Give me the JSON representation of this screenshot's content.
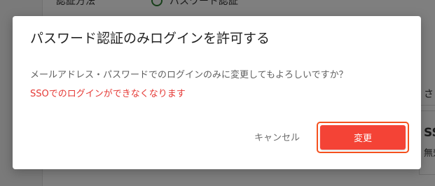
{
  "background": {
    "row_label": "認証方法",
    "row_value": "パスワード認証",
    "right_text_1": "さ",
    "right_text_2": "SSO",
    "right_text_3": "無効"
  },
  "dialog": {
    "title": "パスワード認証のみログインを許可する",
    "message": "メールアドレス・パスワードでのログインのみに変更してもよろしいですか？",
    "warning": "SSOでのログインができなくなります",
    "cancel_label": "キャンセル",
    "confirm_label": "変更"
  },
  "colors": {
    "confirm_button": "#f44336",
    "warning_text": "#e53935",
    "focus_ring": "#f4511e"
  }
}
